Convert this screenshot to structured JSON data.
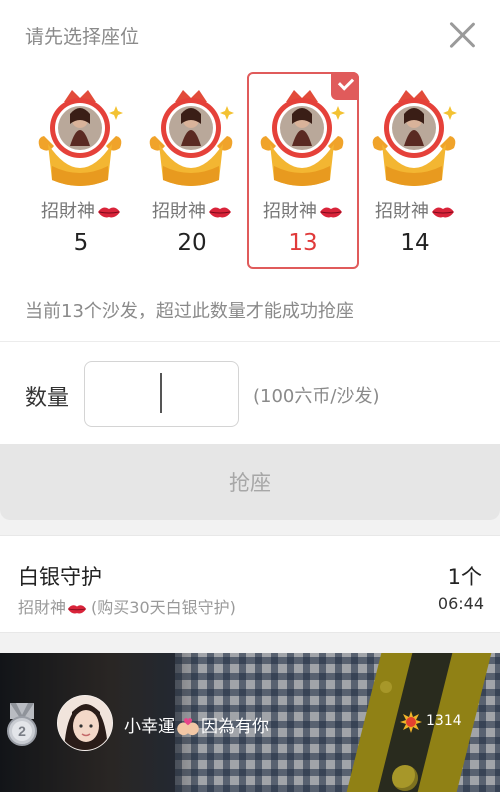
{
  "sheet": {
    "title": "请先选择座位",
    "seats": [
      {
        "name": "招財神",
        "count": "5",
        "selected": false
      },
      {
        "name": "招財神",
        "count": "20",
        "selected": false
      },
      {
        "name": "招財神",
        "count": "13",
        "selected": true
      },
      {
        "name": "招財神",
        "count": "14",
        "selected": false
      }
    ],
    "hint": "当前13个沙发，超过此数量才能成功抢座",
    "quantity_label": "数量",
    "quantity_value": "",
    "price_note": "(100六币/沙发)",
    "grab_label": "抢座"
  },
  "guard": {
    "title": "白银守护",
    "sub_name": "招財神",
    "sub_note": "(购买30天白银守护)",
    "count": "1个",
    "time": "06:44"
  },
  "chat": {
    "rank": "2",
    "user_name_a": "小幸運",
    "user_name_b": "因為有你",
    "value": "1314"
  },
  "colors": {
    "accent": "#e05b5b",
    "selected_count": "#e03a3a",
    "hint_text": "#8a8a8a"
  },
  "icons": [
    "close-icon",
    "throne-avatar-icon",
    "lips-icon",
    "check-icon",
    "rank-medal-icon",
    "sun-badge-icon"
  ]
}
